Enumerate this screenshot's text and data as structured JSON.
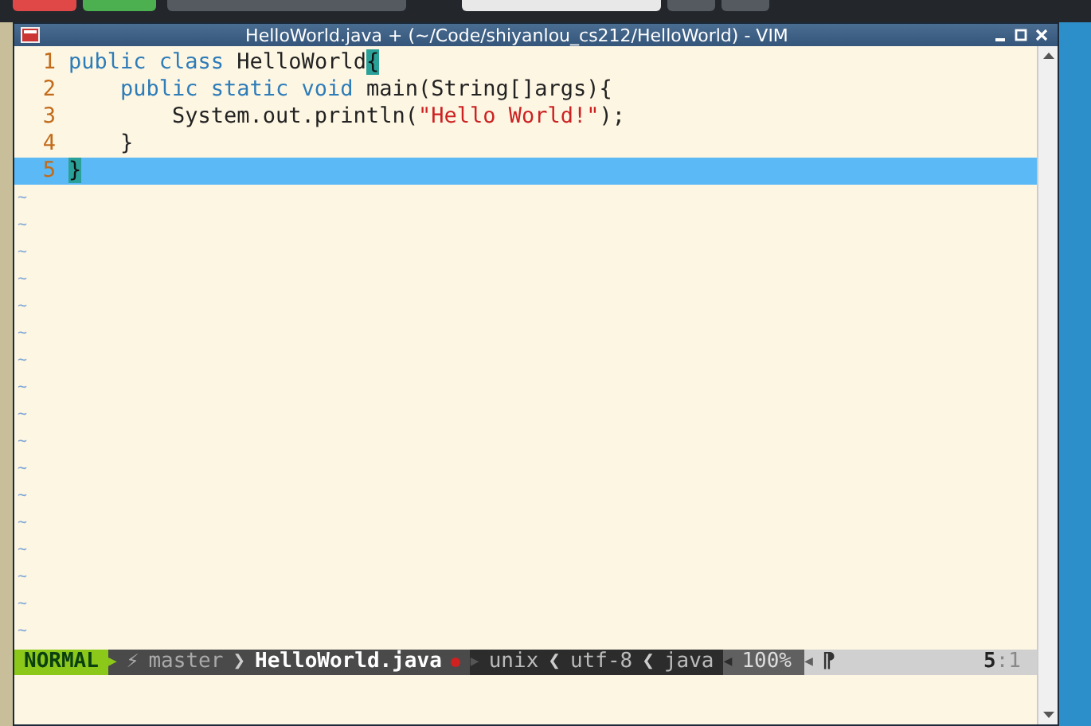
{
  "window": {
    "title": "HelloWorld.java + (~/Code/shiyanlou_cs212/HelloWorld) - VIM"
  },
  "editor": {
    "lines": [
      {
        "number": "1",
        "selected": false,
        "tokens": [
          {
            "kind": "keyword",
            "text": "public class "
          },
          {
            "kind": "plain",
            "text": "HelloWorld"
          },
          {
            "kind": "match",
            "text": "{"
          }
        ]
      },
      {
        "number": "2",
        "selected": false,
        "tokens": [
          {
            "kind": "keyword",
            "text": "    public static void "
          },
          {
            "kind": "plain",
            "text": "main(String[]args){"
          }
        ]
      },
      {
        "number": "3",
        "selected": false,
        "tokens": [
          {
            "kind": "plain",
            "text": "        System.out.println("
          },
          {
            "kind": "string",
            "text": "\"Hello World!\""
          },
          {
            "kind": "plain",
            "text": ");"
          }
        ]
      },
      {
        "number": "4",
        "selected": false,
        "tokens": [
          {
            "kind": "plain",
            "text": "    }"
          }
        ]
      },
      {
        "number": "5",
        "selected": true,
        "tokens": [
          {
            "kind": "match",
            "text": "}"
          }
        ]
      }
    ],
    "filler_lines": [
      "~",
      "~",
      "~",
      "~",
      "~",
      "~",
      "~",
      "~",
      "~",
      "~",
      "~",
      "~",
      "~",
      "~",
      "~",
      "~",
      "~"
    ]
  },
  "status_line": {
    "mode": "NORMAL",
    "mode_arrow": "▶",
    "branch_icon": "⚡",
    "branch": "master",
    "separator": "❯",
    "file": "HelloWorld.java",
    "modified": true,
    "file_arrow": "▶",
    "format": "unix",
    "encoding": "utf-8",
    "filetype": "java",
    "format_separators": [
      "❮",
      "❮"
    ],
    "percent_arrow": "◀",
    "percent": "100%",
    "position_arrow": "◀",
    "position_icon": "⁋",
    "line": "5",
    "column": ":1"
  }
}
